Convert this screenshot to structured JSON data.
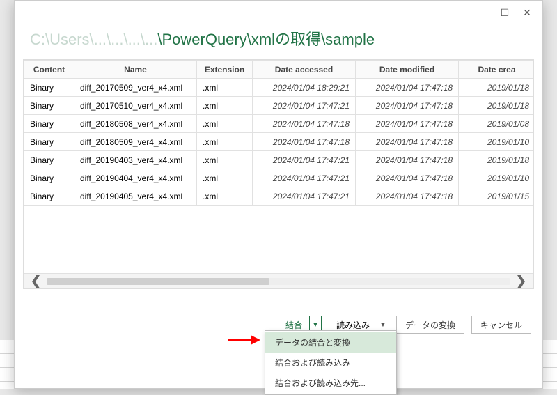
{
  "window": {
    "maximize_glyph": "☐",
    "close_glyph": "✕"
  },
  "path": {
    "prefix": "C:\\Users\\...\\...\\...\\...",
    "visible": "\\PowerQuery\\xmlの取得\\sample"
  },
  "table": {
    "headers": [
      "Content",
      "Name",
      "Extension",
      "Date accessed",
      "Date modified",
      "Date crea"
    ],
    "rows": [
      {
        "content": "Binary",
        "name": "diff_20170509_ver4_x4.xml",
        "ext": ".xml",
        "accessed": "2024/01/04 18:29:21",
        "modified": "2024/01/04 17:47:18",
        "created": "2019/01/18"
      },
      {
        "content": "Binary",
        "name": "diff_20170510_ver4_x4.xml",
        "ext": ".xml",
        "accessed": "2024/01/04 17:47:21",
        "modified": "2024/01/04 17:47:18",
        "created": "2019/01/18"
      },
      {
        "content": "Binary",
        "name": "diff_20180508_ver4_x4.xml",
        "ext": ".xml",
        "accessed": "2024/01/04 17:47:18",
        "modified": "2024/01/04 17:47:18",
        "created": "2019/01/08"
      },
      {
        "content": "Binary",
        "name": "diff_20180509_ver4_x4.xml",
        "ext": ".xml",
        "accessed": "2024/01/04 17:47:18",
        "modified": "2024/01/04 17:47:18",
        "created": "2019/01/10"
      },
      {
        "content": "Binary",
        "name": "diff_20190403_ver4_x4.xml",
        "ext": ".xml",
        "accessed": "2024/01/04 17:47:21",
        "modified": "2024/01/04 17:47:18",
        "created": "2019/01/18"
      },
      {
        "content": "Binary",
        "name": "diff_20190404_ver4_x4.xml",
        "ext": ".xml",
        "accessed": "2024/01/04 17:47:21",
        "modified": "2024/01/04 17:47:18",
        "created": "2019/01/10"
      },
      {
        "content": "Binary",
        "name": "diff_20190405_ver4_x4.xml",
        "ext": ".xml",
        "accessed": "2024/01/04 17:47:21",
        "modified": "2024/01/04 17:47:18",
        "created": "2019/01/15"
      }
    ]
  },
  "footer": {
    "combine": "結合",
    "load": "読み込み",
    "transform": "データの変換",
    "cancel": "キャンセル",
    "caret": "▼"
  },
  "menu": {
    "items": [
      "データの結合と変換",
      "結合および読み込み",
      "結合および読み込み先..."
    ]
  }
}
